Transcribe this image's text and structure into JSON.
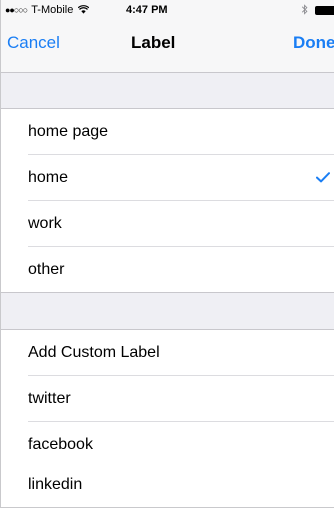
{
  "status_bar": {
    "carrier": "T-Mobile",
    "time": "4:47 PM",
    "signal_icon": "signal-dots-icon",
    "wifi_icon": "wifi-icon",
    "bluetooth_icon": "bluetooth-icon",
    "battery_icon": "battery-icon"
  },
  "nav": {
    "cancel_label": "Cancel",
    "title": "Label",
    "done_label": "Done"
  },
  "colors": {
    "accent": "#1a7ef4",
    "group_background": "#efeff4",
    "separator": "#dcdce0"
  },
  "sections": [
    {
      "items": [
        {
          "label": "home page",
          "selected": false
        },
        {
          "label": "home",
          "selected": true
        },
        {
          "label": "work",
          "selected": false
        },
        {
          "label": "other",
          "selected": false
        }
      ]
    },
    {
      "items": [
        {
          "label": "Add Custom Label",
          "selected": false
        },
        {
          "label": "twitter",
          "selected": false
        },
        {
          "label": "facebook",
          "selected": false
        },
        {
          "label": "linkedin",
          "selected": false
        }
      ]
    }
  ]
}
